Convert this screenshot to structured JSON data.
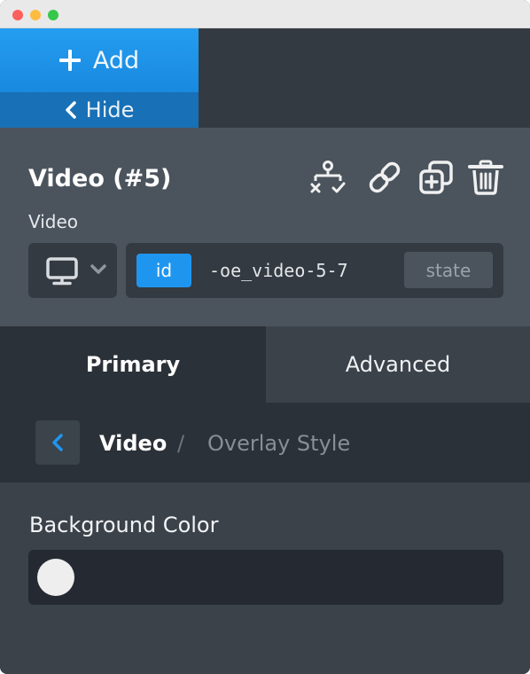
{
  "toolbar": {
    "add_label": "Add",
    "hide_label": "Hide"
  },
  "element": {
    "title": "Video (#5)",
    "type_label": "Video",
    "actions": [
      "structure-icon",
      "link-icon",
      "duplicate-icon",
      "delete-icon"
    ],
    "device_icon": "desktop-icon",
    "id_badge": "id",
    "id_value": "-oe_video-5-7",
    "state_label": "state"
  },
  "tabs": {
    "primary": "Primary",
    "advanced": "Advanced",
    "active": "Primary"
  },
  "breadcrumb": {
    "current": "Video",
    "separator": "/",
    "next": "Overlay Style"
  },
  "fields": {
    "background_color": {
      "label": "Background Color",
      "value": "#eeeeee"
    }
  },
  "colors": {
    "accent": "#1e96f0",
    "add_button": "#1989e0",
    "hide_button": "#1870b6",
    "panel": "#4b545d",
    "dark": "#2b3138"
  }
}
